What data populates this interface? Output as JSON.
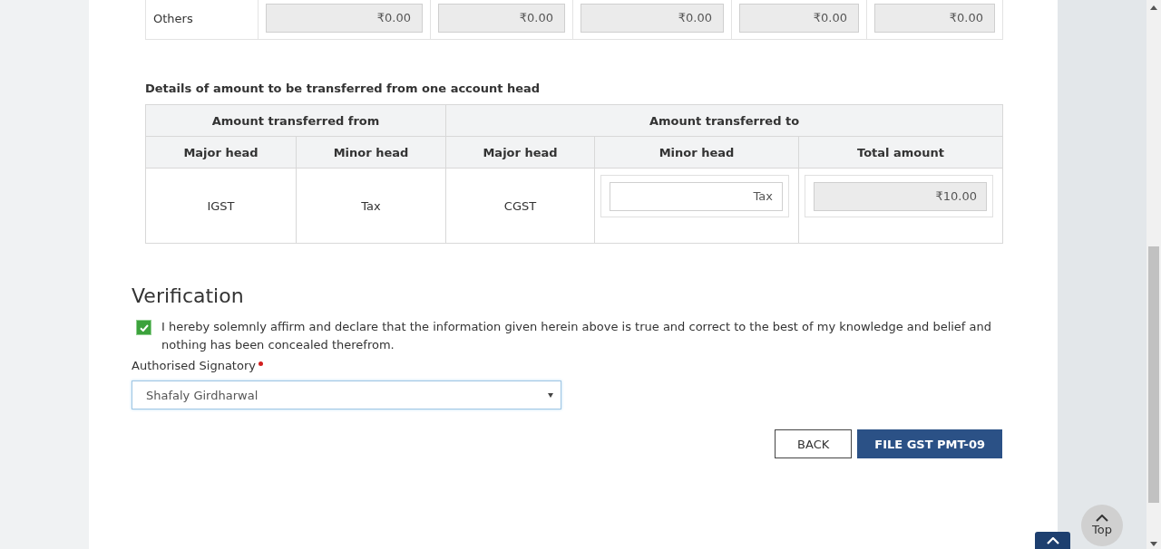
{
  "others_row": {
    "label": "Others",
    "amounts": [
      {
        "value": "₹0.00",
        "disabled": true
      },
      {
        "value": "₹0.00",
        "disabled": true
      },
      {
        "value": "₹0.00",
        "disabled": true
      },
      {
        "value": "₹0.00",
        "disabled": true
      },
      {
        "value": "₹0.00",
        "disabled": true
      }
    ]
  },
  "transfer_section": {
    "title": "Details of amount to be transferred from one account head",
    "column_groups": [
      {
        "label": "Amount transferred from",
        "columns": [
          "Major head",
          "Minor head"
        ]
      },
      {
        "label": "Amount transferred to",
        "columns": [
          "Major head",
          "Minor head",
          "Total amount"
        ]
      }
    ],
    "rows": [
      {
        "cells": [
          {
            "kind": "text",
            "value": "IGST"
          },
          {
            "kind": "text",
            "value": "Tax"
          },
          {
            "kind": "text",
            "value": "CGST"
          },
          {
            "kind": "input",
            "value": "Tax",
            "disabled": false
          },
          {
            "kind": "input",
            "value": "₹10.00",
            "disabled": true
          }
        ]
      }
    ]
  },
  "verification": {
    "title": "Verification",
    "declaration": {
      "checked": true,
      "text": "I hereby solemnly affirm and declare that the information given herein above is true and correct to the best of my knowledge and belief and nothing has been concealed therefrom."
    },
    "signatory": {
      "label": "Authorised Signatory",
      "required": true,
      "value": "Shafaly Girdharwal"
    }
  },
  "buttons": [
    {
      "label": "BACK",
      "kind": "secondary"
    },
    {
      "label": "FILE GST PMT-09",
      "kind": "primary"
    }
  ],
  "top_button": {
    "label": "Top"
  }
}
